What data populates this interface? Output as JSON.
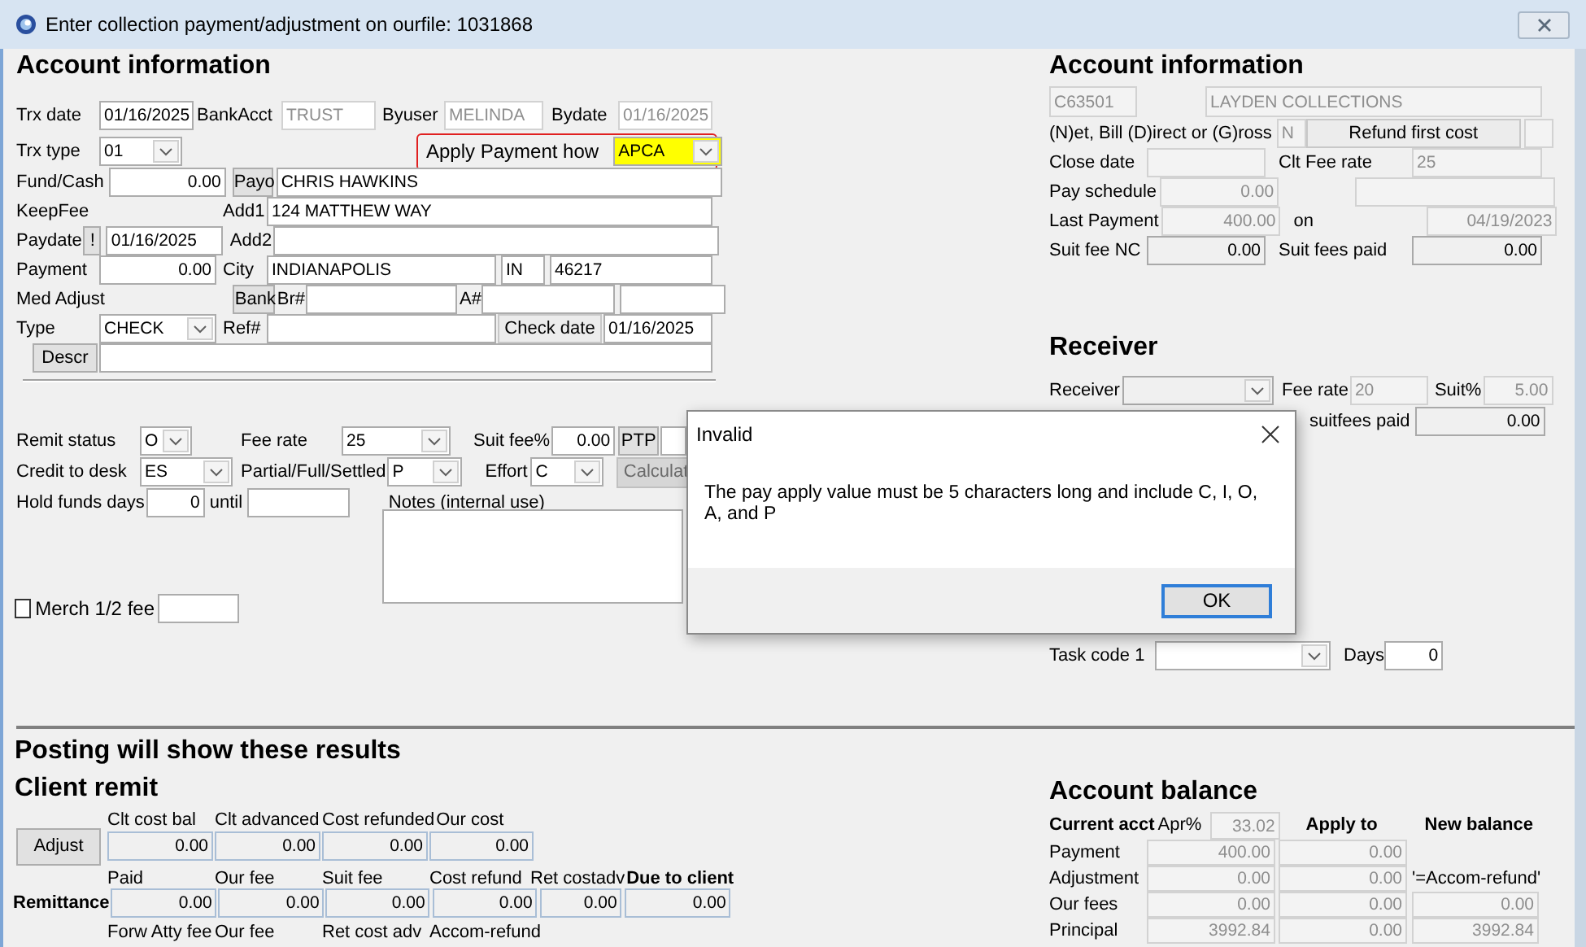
{
  "window": {
    "title": "Enter collection payment/adjustment on ourfile: 1031868"
  },
  "account_panel": {
    "lines": [
      {
        "items": [
          {
            "kind": "heading",
            "text": "Account information"
          }
        ]
      },
      {
        "items": [
          {
            "kind": "label",
            "text": "Trx date"
          },
          {
            "kind": "field",
            "value": "01/16/2025",
            "disabled": false
          },
          {
            "kind": "label",
            "text": "BankAcct"
          },
          {
            "kind": "field",
            "value": "TRUST",
            "disabled": true
          },
          {
            "kind": "label",
            "text": "Byuser"
          },
          {
            "kind": "field",
            "value": "MELINDA",
            "disabled": true
          },
          {
            "kind": "label",
            "text": "Bydate"
          },
          {
            "kind": "field",
            "value": "01/16/2025",
            "disabled": true
          }
        ]
      },
      {
        "items": [
          {
            "kind": "label",
            "text": "Trx type"
          },
          {
            "kind": "combo",
            "value": "01"
          },
          {
            "kind": "group",
            "outlined": true,
            "items": [
              {
                "kind": "label",
                "text": "Apply Payment how"
              },
              {
                "kind": "marked_combo",
                "value": "APCA"
              }
            ]
          }
        ]
      },
      {
        "items": [
          {
            "kind": "label",
            "text": "Fund/Cash"
          },
          {
            "kind": "field",
            "value": "0.00",
            "disabled": false
          },
          {
            "kind": "button",
            "label": "Payo",
            "disabled": false
          },
          {
            "kind": "field",
            "value": "CHRIS HAWKINS",
            "disabled": false
          }
        ]
      },
      {
        "items": [
          {
            "kind": "label",
            "text": "KeepFee"
          },
          {
            "kind": "label",
            "text": "Add1"
          },
          {
            "kind": "field",
            "value": "124 MATTHEW WAY",
            "disabled": false
          }
        ]
      },
      {
        "items": [
          {
            "kind": "label",
            "text": "Paydate"
          },
          {
            "kind": "button",
            "label": "!",
            "disabled": false
          },
          {
            "kind": "field",
            "value": "01/16/2025",
            "disabled": false
          },
          {
            "kind": "label",
            "text": "Add2"
          },
          {
            "kind": "field",
            "disabled": false
          }
        ]
      },
      {
        "items": [
          {
            "kind": "label",
            "text": "Payment"
          },
          {
            "kind": "field",
            "value": "0.00",
            "disabled": false
          },
          {
            "kind": "label",
            "text": "City"
          },
          {
            "kind": "field",
            "value": "INDIANAPOLIS",
            "disabled": false
          },
          {
            "kind": "field",
            "value": "IN",
            "disabled": false
          },
          {
            "kind": "field",
            "value": "46217",
            "disabled": false
          }
        ]
      },
      {
        "items": [
          {
            "kind": "label",
            "text": "Med Adjust"
          },
          {
            "kind": "button",
            "label": "Bank",
            "disabled": false
          },
          {
            "kind": "label",
            "text": "Br#"
          },
          {
            "kind": "field",
            "disabled": false
          },
          {
            "kind": "label",
            "text": "A#"
          },
          {
            "kind": "field",
            "disabled": false
          },
          {
            "kind": "field",
            "disabled": false
          }
        ]
      },
      {
        "items": [
          {
            "kind": "label",
            "text": "Type"
          },
          {
            "kind": "combo",
            "value": "CHECK"
          },
          {
            "kind": "label",
            "text": "Ref#"
          },
          {
            "kind": "field",
            "disabled": false
          },
          {
            "kind": "boxlabel",
            "text": "Check date"
          },
          {
            "kind": "field",
            "value": "01/16/2025",
            "disabled": false
          }
        ]
      },
      {
        "items": [
          {
            "kind": "button",
            "label": "Descr",
            "disabled": false
          },
          {
            "kind": "field",
            "disabled": false
          }
        ]
      }
    ]
  },
  "options_panel": {
    "lines": [
      {
        "items": [
          {
            "kind": "label",
            "text": "Remit status"
          },
          {
            "kind": "combo",
            "value": "O"
          },
          {
            "kind": "label",
            "text": "Fee rate"
          },
          {
            "kind": "combo",
            "value": "25"
          },
          {
            "kind": "label",
            "text": "Suit fee%"
          },
          {
            "kind": "field",
            "value": "0.00",
            "disabled": false
          },
          {
            "kind": "button",
            "label": "PTP",
            "disabled": false
          },
          {
            "kind": "field",
            "disabled": false
          }
        ]
      },
      {
        "items": [
          {
            "kind": "label",
            "text": "Credit to desk"
          },
          {
            "kind": "combo",
            "value": "ES"
          },
          {
            "kind": "label",
            "text": "Partial/Full/Settled"
          },
          {
            "kind": "combo",
            "value": "P"
          },
          {
            "kind": "label",
            "text": "Effort"
          },
          {
            "kind": "combo",
            "value": "C"
          },
          {
            "kind": "button",
            "label": "Calculat",
            "disabled": true
          }
        ]
      },
      {
        "items": [
          {
            "kind": "label",
            "text": "Hold funds days"
          },
          {
            "kind": "field",
            "value": "0",
            "disabled": false
          },
          {
            "kind": "label",
            "text": "until"
          },
          {
            "kind": "field",
            "disabled": false
          },
          {
            "kind": "label",
            "text": "Notes (internal use)"
          }
        ]
      },
      {
        "items": [
          {
            "kind": "textarea"
          }
        ]
      },
      {
        "items": [
          {
            "kind": "check",
            "label": "Merch 1/2 fee",
            "checked": false
          },
          {
            "kind": "field",
            "disabled": false
          }
        ]
      }
    ]
  },
  "client_panel": {
    "lines": [
      {
        "items": [
          {
            "kind": "heading",
            "text": "Account information"
          }
        ]
      },
      {
        "items": [
          {
            "kind": "field",
            "value": "C63501",
            "disabled": true
          },
          {
            "kind": "field",
            "value": "LAYDEN COLLECTIONS",
            "disabled": true
          }
        ]
      },
      {
        "items": [
          {
            "kind": "label",
            "text": "(N)et, Bill (D)irect or (G)ross"
          },
          {
            "kind": "field",
            "value": "N",
            "disabled": true
          },
          {
            "kind": "boxlabel",
            "text": "Refund first cost"
          },
          {
            "kind": "field",
            "disabled": true
          }
        ]
      },
      {
        "items": [
          {
            "kind": "label",
            "text": "Close date"
          },
          {
            "kind": "field",
            "disabled": true
          },
          {
            "kind": "label",
            "text": "Clt Fee rate"
          },
          {
            "kind": "field",
            "value": "25",
            "disabled": true
          }
        ]
      },
      {
        "items": [
          {
            "kind": "label",
            "text": "Pay schedule"
          },
          {
            "kind": "field",
            "value": "0.00",
            "disabled": true
          },
          {
            "kind": "field",
            "disabled": true
          }
        ]
      },
      {
        "items": [
          {
            "kind": "label",
            "text": "Last Payment"
          },
          {
            "kind": "field",
            "value": "400.00",
            "disabled": true
          },
          {
            "kind": "label",
            "text": "on"
          },
          {
            "kind": "field",
            "value": "04/19/2023",
            "disabled": true
          }
        ]
      },
      {
        "items": [
          {
            "kind": "label",
            "text": "Suit fee NC"
          },
          {
            "kind": "field",
            "value": "0.00",
            "disabled": false
          },
          {
            "kind": "label",
            "text": "Suit fees paid"
          },
          {
            "kind": "field",
            "value": "0.00",
            "disabled": false
          }
        ]
      }
    ]
  },
  "receiver_panel": {
    "lines": [
      {
        "items": [
          {
            "kind": "heading",
            "text": "Receiver"
          }
        ]
      },
      {
        "items": [
          {
            "kind": "label",
            "text": "Receiver"
          },
          {
            "kind": "combo"
          },
          {
            "kind": "label",
            "text": "Fee rate"
          },
          {
            "kind": "field",
            "value": "20",
            "disabled": true
          },
          {
            "kind": "label",
            "text": "Suit%"
          },
          {
            "kind": "field",
            "value": "5.00",
            "disabled": true
          }
        ]
      },
      {
        "items": [
          {
            "kind": "label",
            "text": "suitfees paid"
          },
          {
            "kind": "field",
            "value": "0.00",
            "disabled": false
          }
        ]
      }
    ]
  },
  "task_panel": {
    "lines": [
      {
        "items": [
          {
            "kind": "label",
            "text": "Task code 1"
          },
          {
            "kind": "combo"
          },
          {
            "kind": "label",
            "text": "Days"
          },
          {
            "kind": "field",
            "value": "0",
            "disabled": false
          }
        ]
      }
    ]
  },
  "posting_panel": {
    "lines": [
      {
        "items": [
          {
            "kind": "heading",
            "text": "Posting will show these results"
          }
        ]
      },
      {
        "items": [
          {
            "kind": "heading",
            "text": "Client remit"
          }
        ]
      },
      {
        "items": [
          {
            "kind": "label",
            "text": "Clt cost bal"
          },
          {
            "kind": "label",
            "text": "Clt advanced"
          },
          {
            "kind": "label",
            "text": "Cost refunded"
          },
          {
            "kind": "label",
            "text": "Our cost"
          }
        ]
      },
      {
        "items": [
          {
            "kind": "button",
            "label": "Adjust",
            "disabled": false
          },
          {
            "kind": "field",
            "value": "0.00",
            "disabled": false
          },
          {
            "kind": "field",
            "value": "0.00",
            "disabled": false
          },
          {
            "kind": "field",
            "value": "0.00",
            "disabled": false
          },
          {
            "kind": "field",
            "value": "0.00",
            "disabled": false
          }
        ]
      },
      {
        "items": [
          {
            "kind": "label",
            "text": "Paid"
          },
          {
            "kind": "label",
            "text": "Our fee"
          },
          {
            "kind": "label",
            "text": "Suit fee"
          },
          {
            "kind": "label",
            "text": "Cost refund"
          },
          {
            "kind": "label",
            "text": "Ret costadv"
          },
          {
            "kind": "strong",
            "text": "Due to client"
          }
        ]
      },
      {
        "items": [
          {
            "kind": "strong",
            "text": "Remittance"
          },
          {
            "kind": "field",
            "value": "0.00",
            "disabled": false
          },
          {
            "kind": "field",
            "value": "0.00",
            "disabled": false
          },
          {
            "kind": "field",
            "value": "0.00",
            "disabled": false
          },
          {
            "kind": "field",
            "value": "0.00",
            "disabled": false
          },
          {
            "kind": "field",
            "value": "0.00",
            "disabled": false
          },
          {
            "kind": "field",
            "value": "0.00",
            "disabled": false
          }
        ]
      },
      {
        "items": [
          {
            "kind": "label",
            "text": "Forw Atty fee"
          },
          {
            "kind": "label",
            "text": "Our fee"
          },
          {
            "kind": "label",
            "text": "Ret cost adv"
          },
          {
            "kind": "label",
            "text": "Accom-refund"
          }
        ]
      }
    ]
  },
  "balance_panel": {
    "lines": [
      {
        "items": [
          {
            "kind": "heading",
            "text": "Account balance"
          }
        ]
      },
      {
        "items": [
          {
            "kind": "strong",
            "text": "Current acct"
          },
          {
            "kind": "label",
            "text": "Apr%"
          },
          {
            "kind": "field",
            "value": "33.02",
            "disabled": true
          },
          {
            "kind": "strong",
            "text": "Apply to"
          },
          {
            "kind": "strong",
            "text": "New balance"
          }
        ]
      },
      {
        "items": [
          {
            "kind": "label",
            "text": "Payment"
          },
          {
            "kind": "field",
            "value": "400.00",
            "disabled": true
          },
          {
            "kind": "field",
            "value": "0.00",
            "disabled": true
          }
        ]
      },
      {
        "items": [
          {
            "kind": "label",
            "text": "Adjustment"
          },
          {
            "kind": "field",
            "value": "0.00",
            "disabled": true
          },
          {
            "kind": "field",
            "value": "0.00",
            "disabled": true
          },
          {
            "kind": "label",
            "text": "'=Accom-refund'"
          }
        ]
      },
      {
        "items": [
          {
            "kind": "label",
            "text": "Our fees"
          },
          {
            "kind": "field",
            "value": "0.00",
            "disabled": true
          },
          {
            "kind": "field",
            "value": "0.00",
            "disabled": true
          },
          {
            "kind": "field",
            "value": "0.00",
            "disabled": true
          }
        ]
      },
      {
        "items": [
          {
            "kind": "label",
            "text": "Principal"
          },
          {
            "kind": "field",
            "value": "3992.84",
            "disabled": true
          },
          {
            "kind": "field",
            "value": "0.00",
            "disabled": true
          },
          {
            "kind": "field",
            "value": "3992.84",
            "disabled": true
          }
        ]
      }
    ]
  },
  "dialog": {
    "title": "Invalid",
    "message": "The pay apply value must be 5 characters long and include C, I, O, A, and P",
    "buttons": [
      "OK"
    ]
  }
}
